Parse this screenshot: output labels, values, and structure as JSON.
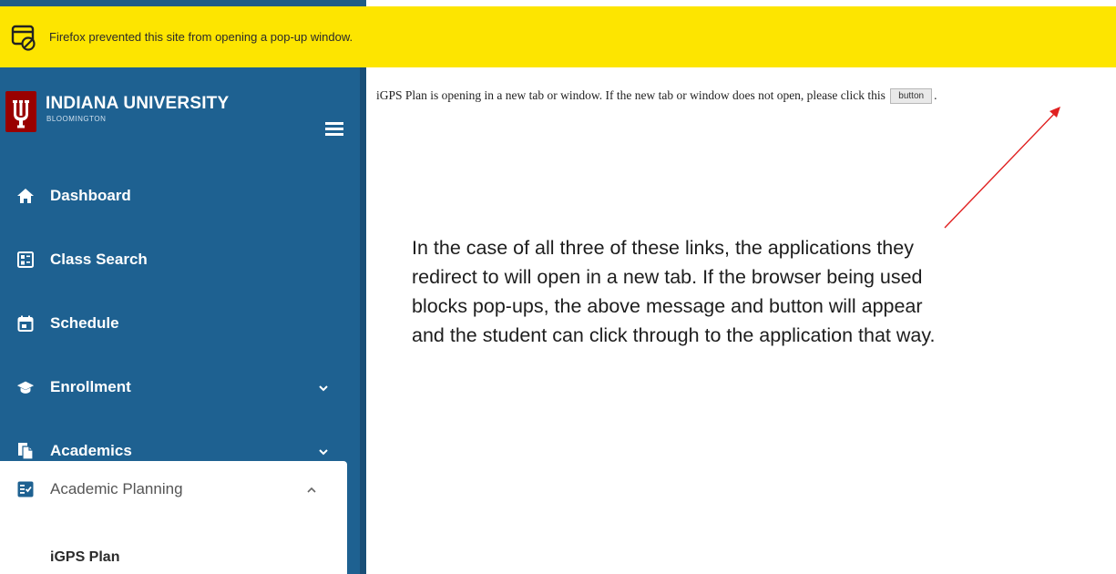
{
  "notification": {
    "message": "Firefox prevented this site from opening a pop-up window.",
    "icon": "blocked-popup-icon",
    "color": "#fde500"
  },
  "sidebar": {
    "university": "INDIANA UNIVERSITY",
    "campus": "BLOOMINGTON",
    "logo": "trident-logo",
    "menu_icon": "hamburger-icon",
    "items": [
      {
        "label": "Dashboard",
        "icon": "home-icon"
      },
      {
        "label": "Class Search",
        "icon": "class-search-icon"
      },
      {
        "label": "Schedule",
        "icon": "calendar-icon"
      },
      {
        "label": "Enrollment",
        "icon": "graduation-cap-icon",
        "expand": "chevron-down"
      },
      {
        "label": "Academics",
        "icon": "documents-icon",
        "expand": "chevron-down"
      },
      {
        "label": "Academic Planning",
        "icon": "checklist-icon",
        "expand": "chevron-up"
      }
    ],
    "sub_items": [
      {
        "label": "iGPS Plan"
      }
    ],
    "colors": {
      "background": "#1e6191",
      "brand": "#990000"
    }
  },
  "main": {
    "message_before": "iGPS Plan is opening in a new tab or window. If the new tab or window does not open, please click this",
    "button_label": "button",
    "message_after": ".",
    "callout_lines": [
      "In the case of all three of these links, the applications they",
      "redirect to will open in a new tab. If the browser being used",
      "blocks pop-ups, the above message and button will appear",
      "and the student can click through to the application that way."
    ],
    "arrow_color": "#e02020"
  }
}
